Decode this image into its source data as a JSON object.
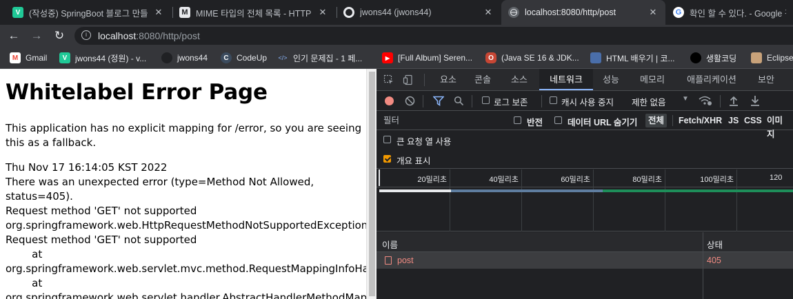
{
  "browser": {
    "tabs": [
      {
        "title": "(작성중) SpringBoot 블로그 만들",
        "favicon": "v-icon",
        "color": "#20c997",
        "letter": "V"
      },
      {
        "title": "MIME 타입의 전체 목록 - HTTP",
        "favicon": "mdn-icon",
        "color": "#202124",
        "letter": "M"
      },
      {
        "title": "jwons44 (jwons44)",
        "favicon": "github-icon",
        "color": "#e8eaed",
        "letter": ""
      },
      {
        "title": "localhost:8080/http/post",
        "favicon": "globe-icon",
        "color": "#9aa0a6",
        "letter": ""
      },
      {
        "title": "확인 할 수 있다. - Google 검",
        "favicon": "google-icon",
        "color": "#ffffff",
        "letter": "G"
      }
    ],
    "url_host": "localhost",
    "url_rest": ":8080/http/post",
    "bookmarks": [
      {
        "label": "Gmail",
        "icon": "gmail-icon",
        "color": "#ea4335",
        "letter": "M"
      },
      {
        "label": "jwons44 (정원) - v...",
        "icon": "velog-icon",
        "color": "#20c997",
        "letter": "V"
      },
      {
        "label": "jwons44",
        "icon": "github-icon",
        "color": "#202124",
        "letter": ""
      },
      {
        "label": "CodeUp",
        "icon": "codeup-icon",
        "color": "#3b4b5e",
        "letter": "C"
      },
      {
        "label": "인기 문제집 - 1 페...",
        "icon": "code-icon",
        "color": "#35363a",
        "letter": "</>"
      },
      {
        "label": "[Full Album] Seren...",
        "icon": "youtube-icon",
        "color": "#ff0000",
        "letter": "▶"
      },
      {
        "label": "(Java SE 16 & JDK...",
        "icon": "oracle-icon",
        "color": "#c74634",
        "letter": "O"
      },
      {
        "label": "HTML 배우기 | 코...",
        "icon": "page-icon",
        "color": "#4a6ea9",
        "letter": ""
      },
      {
        "label": "생활코딩",
        "icon": "circle-icon",
        "color": "#000000",
        "letter": ""
      },
      {
        "label": "Eclipse",
        "icon": "avatar-icon",
        "color": "#c8a27a",
        "letter": ""
      }
    ]
  },
  "page": {
    "title": "Whitelabel Error Page",
    "lines": [
      "This application has no explicit mapping for /error, so you are seeing",
      "this as a fallback.",
      "Thu Nov 17 16:14:05 KST 2022",
      "There was an unexpected error (type=Method Not Allowed,",
      "status=405).",
      "Request method 'GET' not supported",
      "org.springframework.web.HttpRequestMethodNotSupportedException:",
      "Request method 'GET' not supported",
      "        at",
      "org.springframework.web.servlet.mvc.method.RequestMappingInfoHand",
      "        at",
      "org.springframework.web.servlet.handler.AbstractHandlerMethodMappin"
    ]
  },
  "devtools": {
    "tabs": [
      "요소",
      "콘솔",
      "소스",
      "네트워크",
      "성능",
      "메모리",
      "애플리케이션",
      "보안"
    ],
    "active_tab": "네트워크",
    "preserve_log": "로그 보존",
    "disable_cache": "캐시 사용 중지",
    "throttle": "제한 없음",
    "filter_placeholder": "필터",
    "invert": "반전",
    "hide_data_urls": "데이터 URL 숨기기",
    "type_filters": [
      "전체",
      "Fetch/XHR",
      "JS",
      "CSS",
      "이미지"
    ],
    "big_rows": "큰 요청 열 사용",
    "overview": "개요 표시",
    "timeline_ticks": [
      "20밀리초",
      "40밀리초",
      "60밀리초",
      "80밀리초",
      "100밀리초",
      "120"
    ],
    "col_name": "이름",
    "col_status": "상태",
    "requests": [
      {
        "name": "post",
        "status": "405"
      }
    ]
  }
}
